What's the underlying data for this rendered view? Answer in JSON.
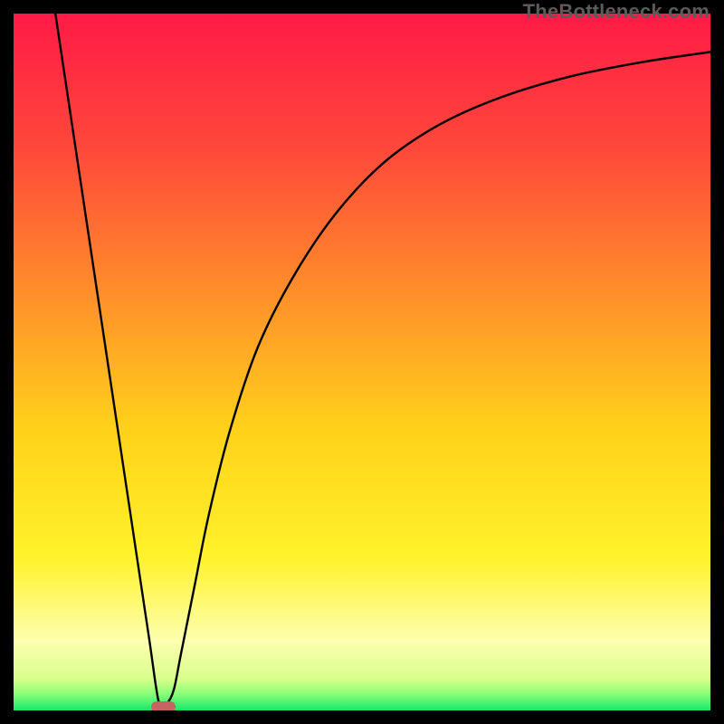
{
  "watermark": "TheBottleneck.com",
  "chart_data": {
    "type": "line",
    "title": "",
    "xlabel": "",
    "ylabel": "",
    "xlim": [
      0,
      100
    ],
    "ylim": [
      0,
      100
    ],
    "grid": false,
    "legend": false,
    "background": {
      "type": "vertical-gradient",
      "stops": [
        {
          "pos": 0.0,
          "color": "#ff1a46"
        },
        {
          "pos": 0.2,
          "color": "#ff4a3a"
        },
        {
          "pos": 0.4,
          "color": "#ff8e2a"
        },
        {
          "pos": 0.6,
          "color": "#ffd21a"
        },
        {
          "pos": 0.78,
          "color": "#fff22a"
        },
        {
          "pos": 0.9,
          "color": "#fcffb0"
        },
        {
          "pos": 0.955,
          "color": "#d8ff8c"
        },
        {
          "pos": 0.975,
          "color": "#8fff7a"
        },
        {
          "pos": 1.0,
          "color": "#17e86a"
        }
      ]
    },
    "series": [
      {
        "name": "bottleneck-curve",
        "color": "#000000",
        "points": [
          {
            "x": 6.0,
            "y": 100.0
          },
          {
            "x": 7.5,
            "y": 90.0
          },
          {
            "x": 9.0,
            "y": 80.0
          },
          {
            "x": 10.5,
            "y": 70.0
          },
          {
            "x": 12.0,
            "y": 60.0
          },
          {
            "x": 13.5,
            "y": 50.0
          },
          {
            "x": 15.0,
            "y": 40.0
          },
          {
            "x": 16.5,
            "y": 30.0
          },
          {
            "x": 18.0,
            "y": 20.0
          },
          {
            "x": 19.5,
            "y": 10.0
          },
          {
            "x": 20.5,
            "y": 3.0
          },
          {
            "x": 21.0,
            "y": 1.0
          },
          {
            "x": 22.0,
            "y": 1.0
          },
          {
            "x": 23.0,
            "y": 3.0
          },
          {
            "x": 24.0,
            "y": 8.0
          },
          {
            "x": 26.0,
            "y": 18.0
          },
          {
            "x": 28.0,
            "y": 28.0
          },
          {
            "x": 31.0,
            "y": 40.0
          },
          {
            "x": 35.0,
            "y": 52.0
          },
          {
            "x": 40.0,
            "y": 62.0
          },
          {
            "x": 46.0,
            "y": 71.0
          },
          {
            "x": 53.0,
            "y": 78.5
          },
          {
            "x": 61.0,
            "y": 84.0
          },
          {
            "x": 70.0,
            "y": 88.0
          },
          {
            "x": 80.0,
            "y": 91.0
          },
          {
            "x": 90.0,
            "y": 93.0
          },
          {
            "x": 100.0,
            "y": 94.5
          }
        ]
      }
    ],
    "marker": {
      "name": "optimal-point",
      "shape": "rounded-rect",
      "color": "#c76360",
      "x": 21.5,
      "y": 0.5,
      "w": 3.5,
      "h": 1.6
    }
  }
}
